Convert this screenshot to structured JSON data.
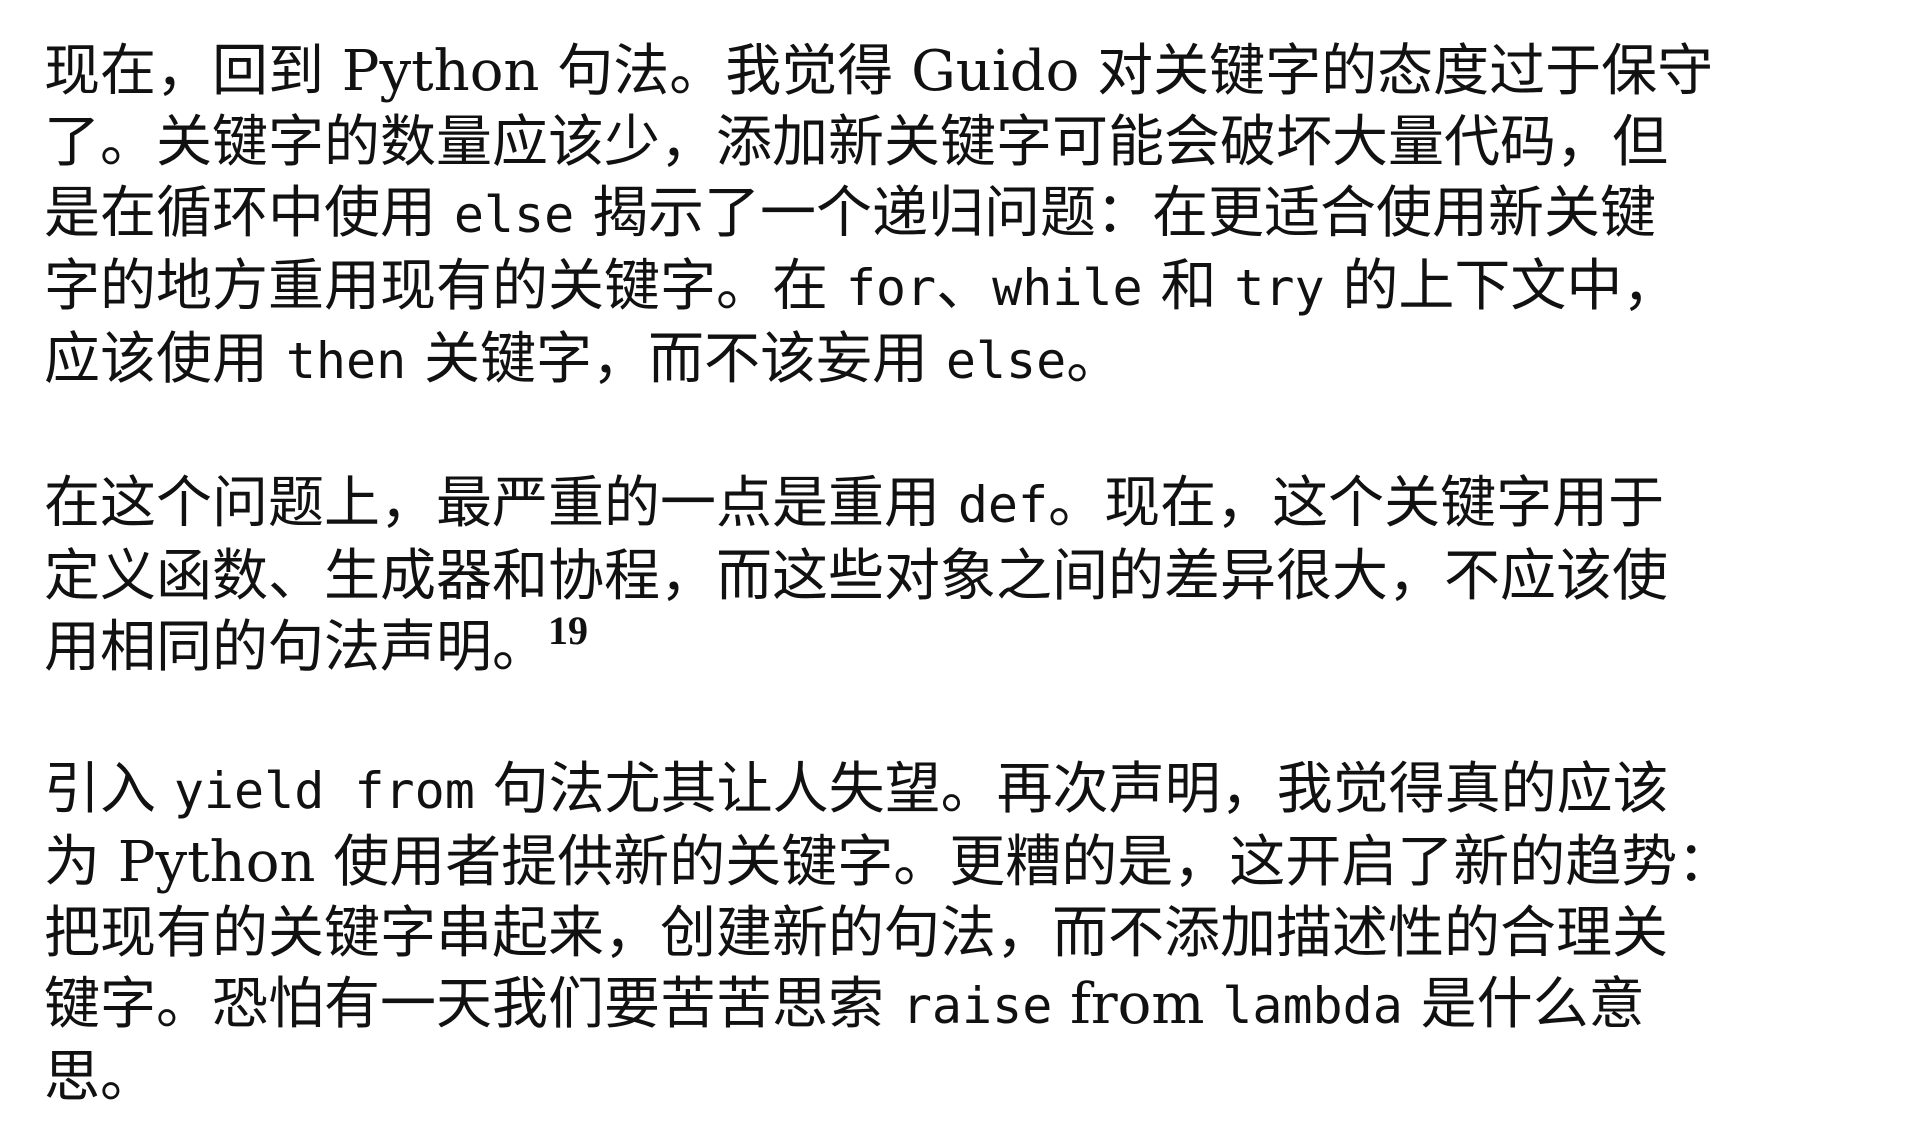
{
  "paragraphs": [
    {
      "lines": [
        [
          "现在，回到 Python 句法。我觉得 Guido 对关键字的态度过于保守"
        ],
        [
          "了。关键字的数量应该少，添加新关键字可能会破坏大量代码，但"
        ],
        [
          "是在循环中使用 ",
          {
            "code": "else"
          },
          " 揭示了一个递归问题：在更适合使用新关键"
        ],
        [
          "字的地方重用现有的关键字。在 ",
          {
            "code": "for"
          },
          "、",
          {
            "code": "while"
          },
          " 和 ",
          {
            "code": "try"
          },
          " 的上下文中，"
        ],
        [
          "应该使用 ",
          {
            "code": "then"
          },
          " 关键字，而不该妄用 ",
          {
            "code": "else"
          },
          "。"
        ]
      ]
    },
    {
      "lines": [
        [
          "在这个问题上，最严重的一点是重用 ",
          {
            "code": "def"
          },
          "。现在，这个关键字用于"
        ],
        [
          "定义函数、生成器和协程，而这些对象之间的差异很大，不应该使"
        ],
        [
          "用相同的句法声明。",
          {
            "sup": "19"
          }
        ]
      ]
    },
    {
      "lines": [
        [
          "引入 ",
          {
            "code": "yield from"
          },
          " 句法尤其让人失望。再次声明，我觉得真的应该"
        ],
        [
          "为 Python 使用者提供新的关键字。更糟的是，这开启了新的趋势："
        ],
        [
          "把现有的关键字串起来，创建新的句法，而不添加描述性的合理关"
        ],
        [
          "键字。恐怕有一天我们要苦苦思索 ",
          {
            "code": "raise"
          },
          " from ",
          {
            "code": "lambda"
          },
          " 是什么意"
        ],
        [
          "思。"
        ]
      ]
    }
  ]
}
